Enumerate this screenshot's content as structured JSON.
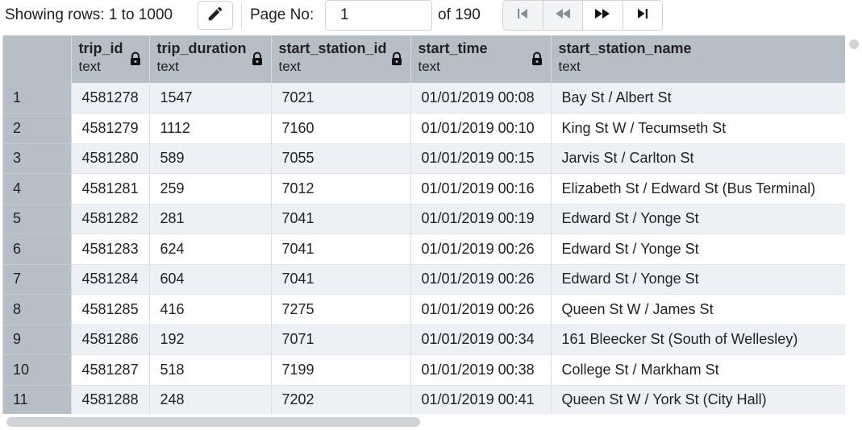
{
  "toolbar": {
    "rows_label": "Showing rows: 1 to 1000",
    "edit_icon": "pencil-icon",
    "page_label": "Page No:",
    "page_value": "1",
    "of_label": "of 190",
    "nav_icons": [
      "first-page-icon",
      "previous-page-icon",
      "next-page-icon",
      "last-page-icon"
    ]
  },
  "grid": {
    "columns": [
      {
        "name": "trip_id",
        "type": "text"
      },
      {
        "name": "trip_duration",
        "type": "text"
      },
      {
        "name": "start_station_id",
        "type": "text"
      },
      {
        "name": "start_time",
        "type": "text"
      },
      {
        "name": "start_station_name",
        "type": "text"
      }
    ],
    "rows": [
      {
        "num": "1",
        "cells": [
          "4581278",
          "1547",
          "7021",
          "01/01/2019 00:08",
          "Bay St / Albert St"
        ]
      },
      {
        "num": "2",
        "cells": [
          "4581279",
          "1112",
          "7160",
          "01/01/2019 00:10",
          "King St W / Tecumseth St"
        ]
      },
      {
        "num": "3",
        "cells": [
          "4581280",
          "589",
          "7055",
          "01/01/2019 00:15",
          "Jarvis St / Carlton St"
        ]
      },
      {
        "num": "4",
        "cells": [
          "4581281",
          "259",
          "7012",
          "01/01/2019 00:16",
          "Elizabeth St / Edward St (Bus Terminal)"
        ]
      },
      {
        "num": "5",
        "cells": [
          "4581282",
          "281",
          "7041",
          "01/01/2019 00:19",
          "Edward St / Yonge St"
        ]
      },
      {
        "num": "6",
        "cells": [
          "4581283",
          "624",
          "7041",
          "01/01/2019 00:26",
          "Edward St / Yonge St"
        ]
      },
      {
        "num": "7",
        "cells": [
          "4581284",
          "604",
          "7041",
          "01/01/2019 00:26",
          "Edward St / Yonge St"
        ]
      },
      {
        "num": "8",
        "cells": [
          "4581285",
          "416",
          "7275",
          "01/01/2019 00:26",
          "Queen St W / James St"
        ]
      },
      {
        "num": "9",
        "cells": [
          "4581286",
          "192",
          "7071",
          "01/01/2019 00:34",
          "161 Bleecker St (South of Wellesley)"
        ]
      },
      {
        "num": "10",
        "cells": [
          "4581287",
          "518",
          "7199",
          "01/01/2019 00:38",
          "College St / Markham St"
        ]
      },
      {
        "num": "11",
        "cells": [
          "4581288",
          "248",
          "7202",
          "01/01/2019 00:41",
          "Queen St W / York St (City Hall)"
        ]
      }
    ]
  }
}
